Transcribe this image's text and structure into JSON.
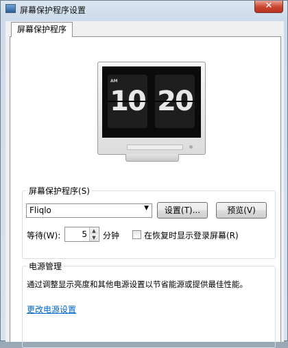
{
  "window": {
    "title": "屏幕保护程序设置",
    "close_glyph": "✕"
  },
  "tab": {
    "label": "屏幕保护程序"
  },
  "preview": {
    "ampm": "AM",
    "hour": "10",
    "minute": "20"
  },
  "screensaver_group": {
    "label": "屏幕保护程序(S)",
    "selected": "Fliqlo",
    "settings_button": "设置(T)...",
    "preview_button": "预览(V)",
    "wait_label": "等待(W):",
    "wait_value": "5",
    "wait_unit": "分钟",
    "resume_checkbox_label": "在恢复时显示登录屏幕(R)",
    "resume_checked": false
  },
  "power_group": {
    "label": "电源管理",
    "description": "通过调整显示亮度和其他电源设置以节省能源或提供最佳性能。",
    "link": "更改电源设置"
  }
}
